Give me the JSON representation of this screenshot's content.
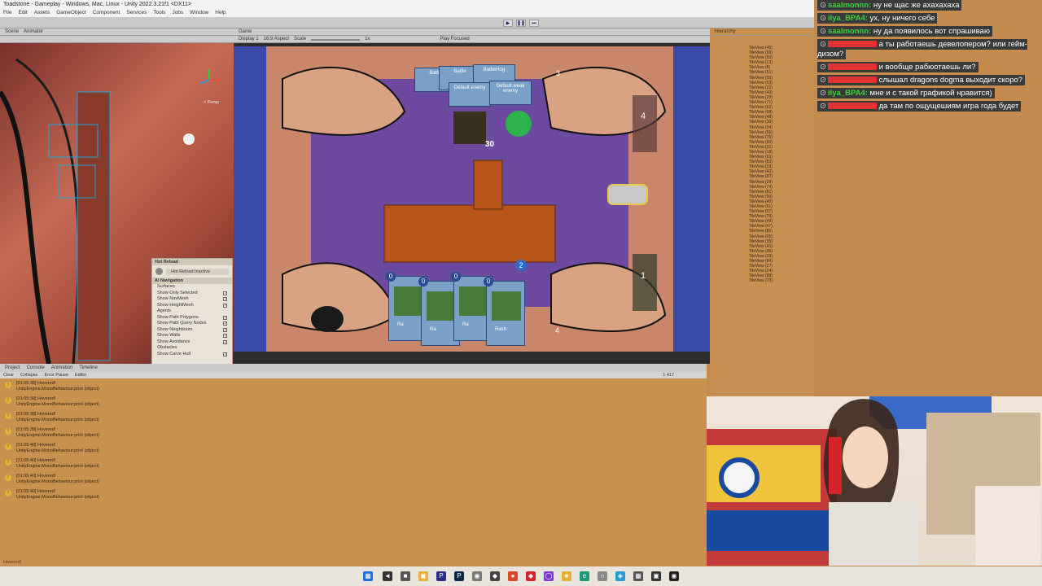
{
  "window": {
    "title": "Toadstone - Gameplay - Windows, Mac, Linux - Unity 2022.3.21f1 <DX11>"
  },
  "menu": [
    "File",
    "Edit",
    "Assets",
    "GameObject",
    "Component",
    "Services",
    "Tools",
    "Jobs",
    "Window",
    "Help"
  ],
  "scene_tabs": {
    "scene": "Scene",
    "animator": "Animator",
    "persp": "< Persp"
  },
  "game_tabs": {
    "game": "Game",
    "display": "Display 1",
    "aspect": "16:9 Aspect",
    "scale": "Scale",
    "scale_value": "1x",
    "play_focused": "Play Focused"
  },
  "hot_reload": {
    "header": "Hot Reload",
    "status": "Hot Reload Inactive"
  },
  "ai_nav": {
    "header": "AI Navigation",
    "rows": [
      {
        "label": "Surfaces",
        "checked": false
      },
      {
        "label": "Show Only Selected",
        "checked": true
      },
      {
        "label": "Show NavMesh",
        "checked": true
      },
      {
        "label": "Show HeightMesh",
        "checked": true
      },
      {
        "label": "Agents",
        "checked": false
      },
      {
        "label": "Show Path Polygons",
        "checked": true
      },
      {
        "label": "Show Path Query Nodes",
        "checked": true
      },
      {
        "label": "Show Neighbours",
        "checked": true
      },
      {
        "label": "Show Walls",
        "checked": true
      },
      {
        "label": "Show Avoidance",
        "checked": true
      },
      {
        "label": "Obstacles",
        "checked": false
      },
      {
        "label": "Show Carve Hull",
        "checked": true
      }
    ]
  },
  "game": {
    "top_cards": [
      "Battle",
      "Battle",
      "BattleHog",
      "Default enemy",
      "Default weak enemy"
    ],
    "top_counter": "3",
    "center_value": "30",
    "right_top_value": "4",
    "right_bottom_value": "1",
    "hand_costs": [
      "0",
      "0",
      "0",
      "0"
    ],
    "hand_labels": [
      "Ra",
      "Ra",
      "Ra",
      "Rash"
    ],
    "bottom_counter": "4",
    "mana_value": "2"
  },
  "hierarchy": {
    "tab": "Hierarchy",
    "items": [
      "TileView (45)",
      "TileView (66)",
      "TileView (50)",
      "TileView (13)",
      "TileView (8)",
      "TileView (51)",
      "TileView (55)",
      "TileView (53)",
      "TileView (22)",
      "TileView (43)",
      "TileView (25)",
      "TileView (71)",
      "TileView (62)",
      "TileView (68)",
      "TileView (48)",
      "TileView (30)",
      "TileView (34)",
      "TileView (56)",
      "TileView (76)",
      "TileView (90)",
      "TileView (31)",
      "TileView (18)",
      "TileView (61)",
      "TileView (83)",
      "TileView (33)",
      "TileView (42)",
      "TileView (87)",
      "TileView (29)",
      "TileView (74)",
      "TileView (81)",
      "TileView (50)",
      "TileView (40)",
      "TileView (91)",
      "TileView (57)",
      "TileView (79)",
      "TileView (49)",
      "TileView (47)",
      "TileView (86)",
      "TileView (65)",
      "TileView (35)",
      "TileView (41)",
      "TileView (46)",
      "TileView (26)",
      "TileView (84)",
      "TileView (27)",
      "TileView (24)",
      "TileView (88)",
      "TileView (70)"
    ]
  },
  "chat": [
    {
      "user": "saalmonnn:",
      "text": " ну не щас же ахахахаха",
      "color": "#3fd13f",
      "status": "top"
    },
    {
      "user": "ilya_BPA4:",
      "text": " ух, ну ничего себе",
      "color": "#3fd13f"
    },
    {
      "user": "saalmonnn:",
      "text": " ну да появилось вот спрашиваю",
      "color": "#3fd13f"
    },
    {
      "user": "",
      "text": " а ты работаешь девелопером? или гейм-дизом?",
      "color": "#e53232"
    },
    {
      "user": "",
      "text": " и вообще рабюотаешь ли?",
      "color": "#e53232"
    },
    {
      "user": "",
      "text": " слышал dragons dogma выходит скоро?",
      "color": "#e53232"
    },
    {
      "user": "ilya_BPA4:",
      "text": " мне и с такой графикой нравится)",
      "color": "#3fd13f"
    },
    {
      "user": "",
      "text": " да там по ощущешиям игра года будет",
      "color": "#e53232"
    }
  ],
  "console": {
    "tabs": [
      "Project",
      "Console",
      "Animation",
      "Timeline"
    ],
    "toolbar": [
      "Clear",
      "Collapse",
      "Error Pause",
      "Editor"
    ],
    "count": "1 417",
    "entries": [
      {
        "time": "[01:05:38] Hovered!",
        "detail": "UnityEngine.MonoBehaviour:print (object)"
      },
      {
        "time": "[01:05:38] Hovered!",
        "detail": "UnityEngine.MonoBehaviour:print (object)"
      },
      {
        "time": "[01:05:38] Hovered!",
        "detail": "UnityEngine.MonoBehaviour:print (object)"
      },
      {
        "time": "[01:05:38] Hovered!",
        "detail": "UnityEngine.MonoBehaviour:print (object)"
      },
      {
        "time": "[01:05:40] Hovered!",
        "detail": "UnityEngine.MonoBehaviour:print (object)"
      },
      {
        "time": "[01:05:40] Hovered!",
        "detail": "UnityEngine.MonoBehaviour:print (object)"
      },
      {
        "time": "[01:05:40] Hovered!",
        "detail": "UnityEngine.MonoBehaviour:print (object)"
      },
      {
        "time": "[01:05:40] Hovered!",
        "detail": "UnityEngine.MonoBehaviour:print (object)"
      }
    ],
    "status": "Hovered!"
  },
  "colors": {
    "accent": "#c58b4e",
    "game_bg": "#6b4aa0",
    "chat_bg": "#3a3a3a"
  }
}
